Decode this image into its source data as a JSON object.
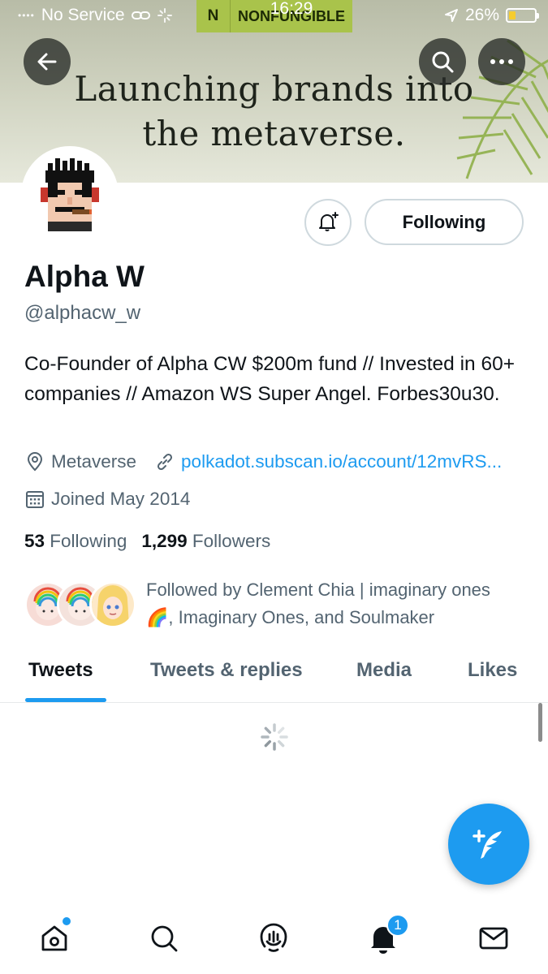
{
  "status_bar": {
    "carrier": "No Service",
    "time": "16:29",
    "overlay_label": "NONFUNGIBLE",
    "overlay_logo": "N",
    "battery": "26%",
    "battery_level": 0.26
  },
  "banner": {
    "line1": "Launching brands into",
    "line2": "the metaverse."
  },
  "profile": {
    "display_name": "Alpha W",
    "handle": "@alphacw_w",
    "bio": "Co-Founder of Alpha CW $200m fund // Invested in 60+ companies // Amazon WS Super Angel. Forbes30u30.",
    "location": "Metaverse",
    "website": "polkadot.subscan.io/account/12mvRS...",
    "joined": "Joined May 2014",
    "following_count": "53",
    "following_label": "Following",
    "followers_count": "1,299",
    "followers_label": "Followers",
    "followed_by": "Followed by Clement Chia | imaginary ones",
    "followed_by_line2": ", Imaginary Ones, and Soulmaker"
  },
  "actions": {
    "following_button": "Following"
  },
  "tabs": [
    "Tweets",
    "Tweets & replies",
    "Media",
    "Likes"
  ],
  "active_tab": "Tweets",
  "bottom_nav": {
    "items": [
      "home-icon",
      "search-icon",
      "spaces-icon",
      "notifications-icon",
      "messages-icon"
    ],
    "notification_badge": "1"
  },
  "colors": {
    "accent": "#1d9bf0",
    "text_primary": "#0f1419",
    "text_secondary": "#536471"
  }
}
